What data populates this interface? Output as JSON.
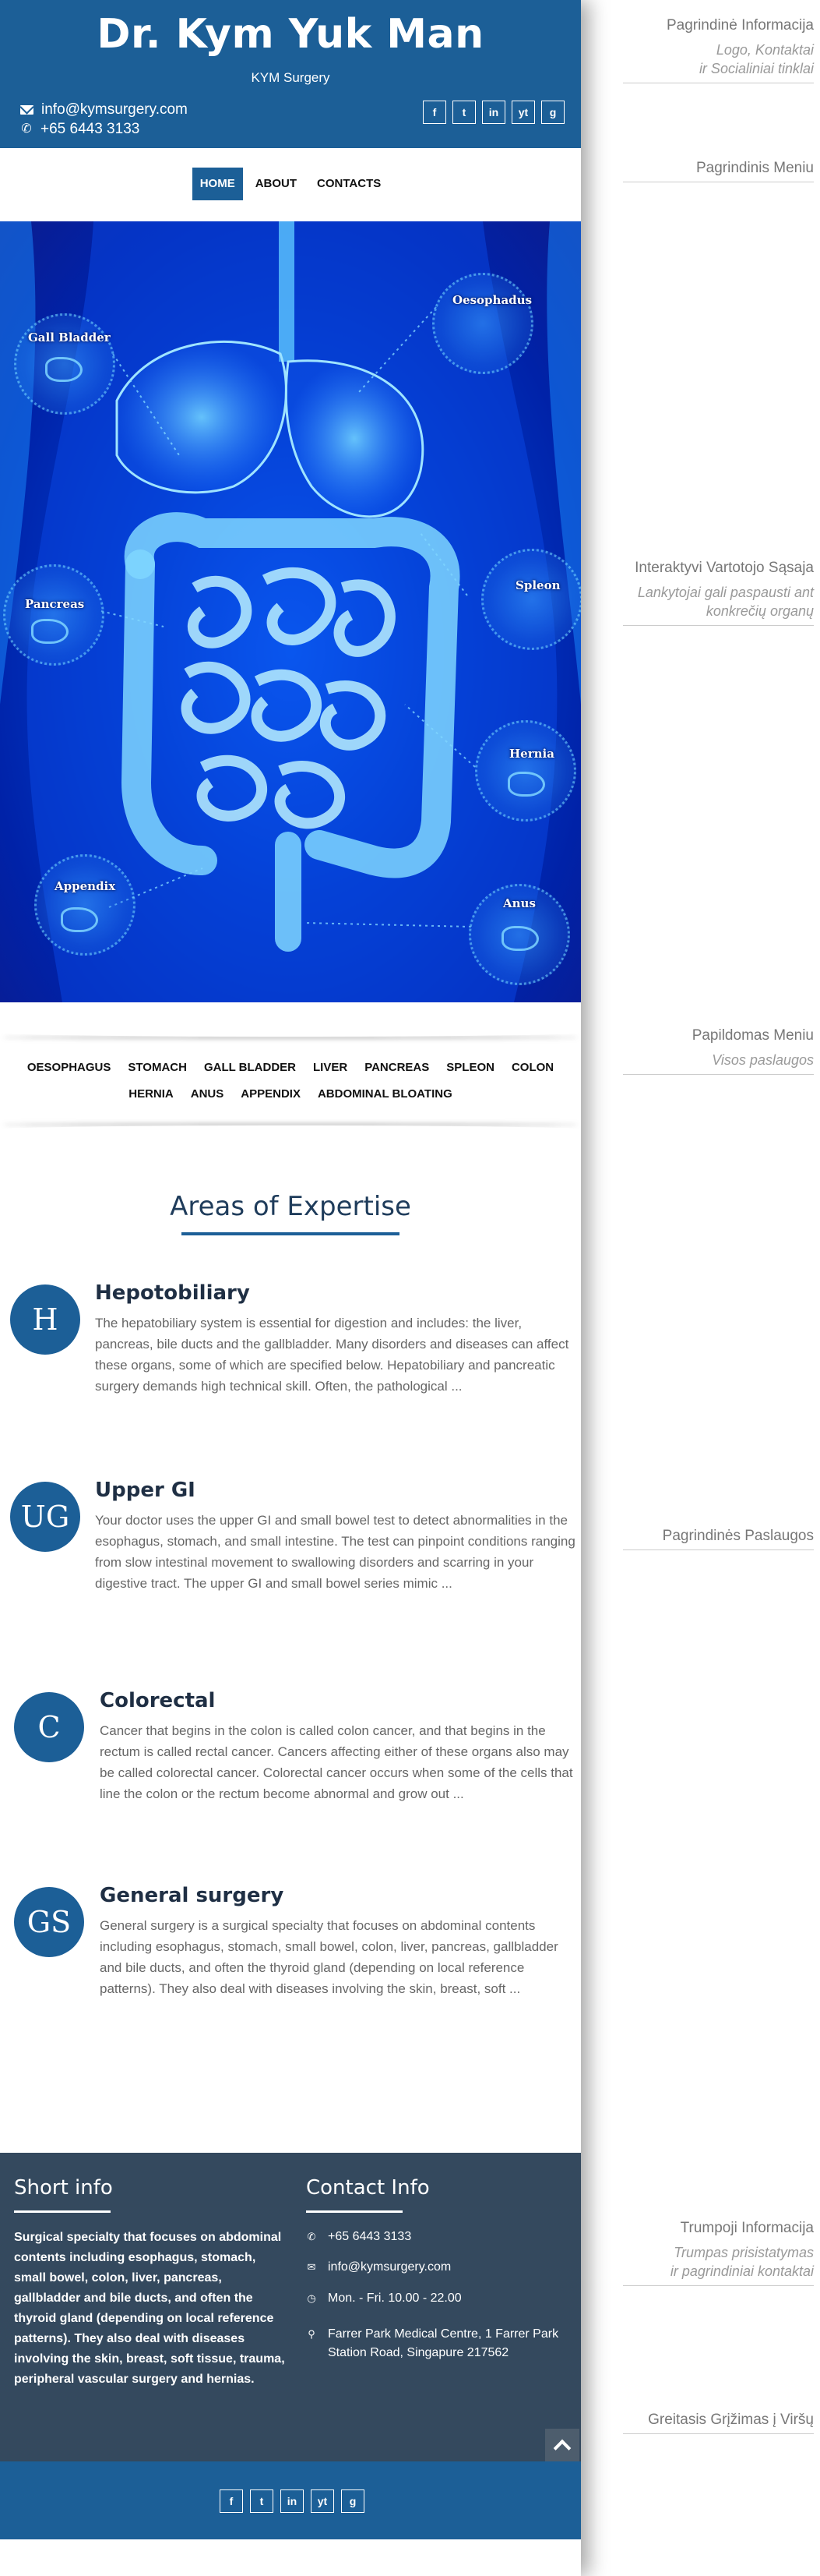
{
  "header": {
    "title": "Dr. Kym Yuk Man",
    "subtitle": "KYM Surgery",
    "email": "info@kymsurgery.com",
    "phone": "+65 6443 3133",
    "social": [
      "f",
      "t",
      "in",
      "yt",
      "g"
    ]
  },
  "main_menu": [
    "HOME",
    "ABOUT",
    "CONTACTS"
  ],
  "anatomy": {
    "labels": {
      "gall_bladder": "Gall Bladder",
      "oesophadus": "Oesophadus",
      "pancreas": "Pancreas",
      "spleon": "Spleon",
      "hernia": "Hernia",
      "appendix": "Appendix",
      "anus": "Anus"
    }
  },
  "extra_menu": {
    "row1": [
      "OESOPHAGUS",
      "STOMACH",
      "GALL BLADDER",
      "LIVER",
      "PANCREAS",
      "SPLEON",
      "COLON"
    ],
    "row2": [
      "HERNIA",
      "ANUS",
      "APPENDIX",
      "ABDOMINAL BLOATING"
    ]
  },
  "expertise": {
    "title": "Areas of Expertise",
    "services": [
      {
        "icon": "H",
        "title": "Hepotobiliary",
        "text": "The hepatobiliary system is essential for digestion and includes: the liver, pancreas, bile ducts and the gallbladder. Many disorders and diseases can affect these organs, some of which are specified below. Hepatobiliary and pancreatic surgery demands high technical skill. Often, the pathological ..."
      },
      {
        "icon": "UG",
        "title": "Upper GI",
        "text": "Your doctor uses the upper GI and small bowel test to detect abnormalities in the esophagus, stomach, and small intestine. The test can pinpoint conditions ranging from slow intestinal movement to swallowing disorders and scarring in your digestive tract. The upper GI and small bowel series mimic ..."
      },
      {
        "icon": "C",
        "title": "Colorectal",
        "text": "Cancer that begins in the colon is called colon cancer, and that begins in the rectum is called rectal cancer. Cancers affecting either of these organs also may be called colorectal cancer. Colorectal cancer occurs when some of the cells that line the colon or the rectum become abnormal and grow out ..."
      },
      {
        "icon": "GS",
        "title": "General surgery",
        "text": "General surgery is a surgical specialty that focuses on abdominal contents including esophagus, stomach, small bowel, colon, liver, pancreas, gallbladder and bile ducts, and often the thyroid gland (depending on local reference patterns). They also deal with diseases involving the skin, breast, soft ..."
      }
    ]
  },
  "footer": {
    "short_heading": "Short info",
    "short_text": "Surgical specialty that focuses on abdominal contents including esophagus, stomach, small bowel, colon, liver, pancreas, gallbladder and bile ducts, and often the thyroid gland (depending on local reference patterns). They also deal with diseases involving the skin, breast, soft tissue, trauma, peripheral vascular surgery and hernias.",
    "contact_heading": "Contact Info",
    "phone": "+65 6443 3133",
    "email": "info@kymsurgery.com",
    "hours": "Mon. - Fri. 10.00 - 22.00",
    "address": "Farrer Park Medical Centre, 1 Farrer Park Station Road, Singapure 217562"
  },
  "bottom_social": [
    "f",
    "t",
    "in",
    "yt",
    "g"
  ],
  "annotations": {
    "a1_title": "Pagrindinė Informacija",
    "a1_sub1": "Logo, Kontaktai",
    "a1_sub2": "ir Socialiniai tinklai",
    "a2_title": "Pagrindinis Meniu",
    "a3_title": "Interaktyvi Vartotojo Sąsaja",
    "a3_sub1": "Lankytojai gali paspausti ant",
    "a3_sub2": "konkrečių organų",
    "a4_title": "Papildomas Meniu",
    "a4_sub1": "Visos paslaugos",
    "a5_title": "Pagrindinės Paslaugos",
    "a6_title": "Trumpoji Informacija",
    "a6_sub1": "Trumpas prisistatymas",
    "a6_sub2": "ir pagrindiniai kontaktai",
    "a7_title": "Greitasis Grįžimas į Viršų"
  },
  "colors": {
    "brand_blue": "#1c5f97",
    "footer_dark": "#34495e",
    "anatomy_blue": "#0033cc"
  }
}
